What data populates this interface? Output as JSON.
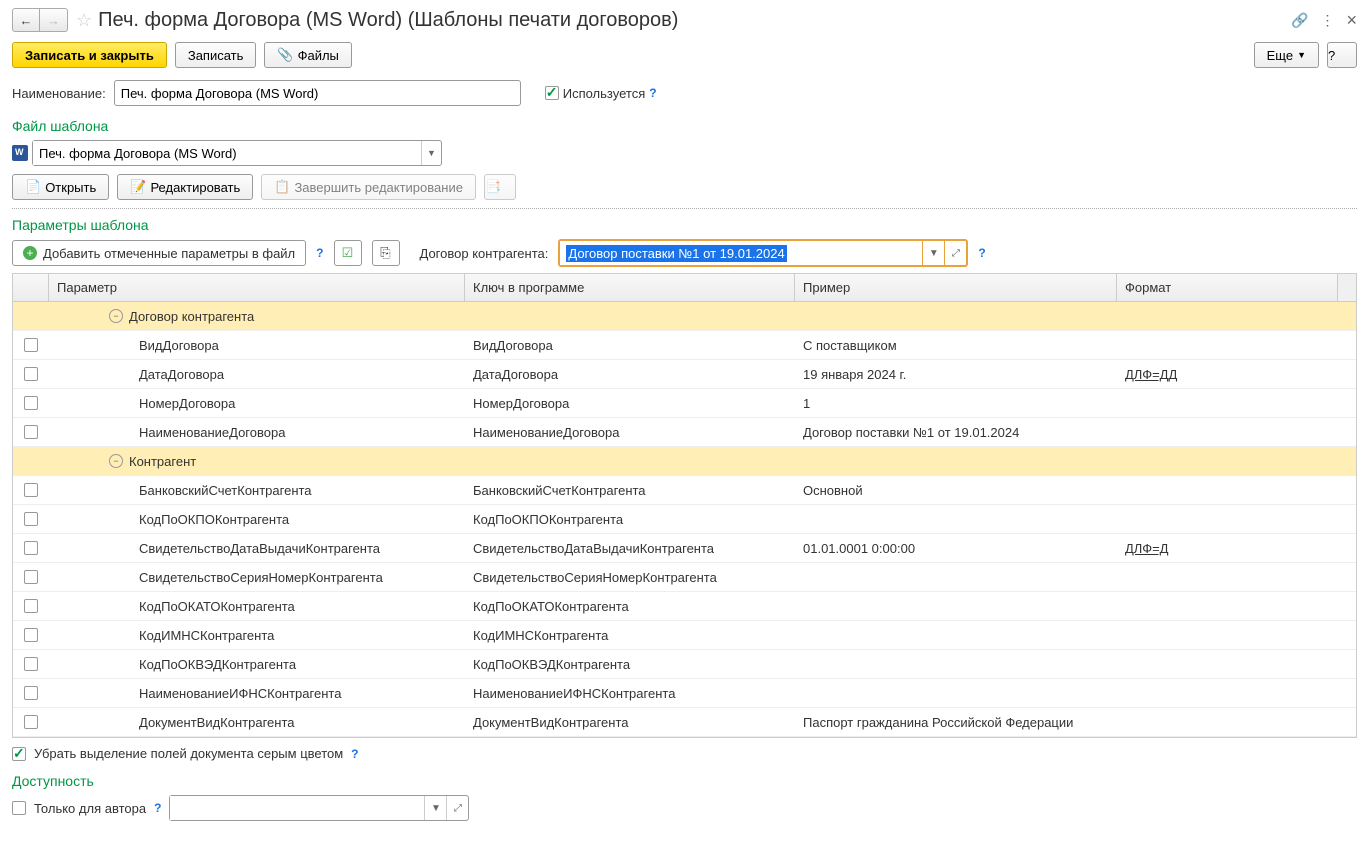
{
  "header": {
    "title": "Печ. форма Договора (MS Word) (Шаблоны печати договоров)"
  },
  "toolbar": {
    "save_close": "Записать и закрыть",
    "save": "Записать",
    "files": "Файлы",
    "more": "Еще"
  },
  "name_field": {
    "label": "Наименование:",
    "value": "Печ. форма Договора (MS Word)",
    "used_label": "Используется"
  },
  "template_file": {
    "title": "Файл шаблона",
    "value": "Печ. форма Договора (MS Word)",
    "open": "Открыть",
    "edit": "Редактировать",
    "finish_edit": "Завершить редактирование"
  },
  "params": {
    "title": "Параметры шаблона",
    "add_btn": "Добавить отмеченные параметры в файл",
    "contract_label": "Договор контрагента:",
    "contract_value": "Договор поставки №1 от 19.01.2024",
    "headers": {
      "param": "Параметр",
      "key": "Ключ в программе",
      "example": "Пример",
      "format": "Формат"
    },
    "rows": [
      {
        "type": "group",
        "indent": 1,
        "param": "Договор контрагента"
      },
      {
        "type": "row",
        "indent": 2,
        "param": "ВидДоговора",
        "key": "ВидДоговора",
        "example": "С поставщиком",
        "format": ""
      },
      {
        "type": "row",
        "indent": 2,
        "param": "ДатаДоговора",
        "key": "ДатаДоговора",
        "example": "19 января 2024 г.",
        "format": "ДЛФ=ДД"
      },
      {
        "type": "row",
        "indent": 2,
        "param": "НомерДоговора",
        "key": "НомерДоговора",
        "example": "1",
        "format": ""
      },
      {
        "type": "row",
        "indent": 2,
        "param": "НаименованиеДоговора",
        "key": "НаименованиеДоговора",
        "example": "Договор поставки №1 от 19.01.2024",
        "format": ""
      },
      {
        "type": "group",
        "indent": 1,
        "param": "Контрагент"
      },
      {
        "type": "row",
        "indent": 2,
        "param": "БанковскийСчетКонтрагента",
        "key": "БанковскийСчетКонтрагента",
        "example": "Основной",
        "format": ""
      },
      {
        "type": "row",
        "indent": 2,
        "param": "КодПоОКПОКонтрагента",
        "key": "КодПоОКПОКонтрагента",
        "example": "",
        "format": ""
      },
      {
        "type": "row",
        "indent": 2,
        "param": "СвидетельствоДатаВыдачиКонтрагента",
        "key": "СвидетельствоДатаВыдачиКонтрагента",
        "example": "01.01.0001 0:00:00",
        "format": "ДЛФ=Д"
      },
      {
        "type": "row",
        "indent": 2,
        "param": "СвидетельствоСерияНомерКонтрагента",
        "key": "СвидетельствоСерияНомерКонтрагента",
        "example": "",
        "format": ""
      },
      {
        "type": "row",
        "indent": 2,
        "param": "КодПоОКАТОКонтрагента",
        "key": "КодПоОКАТОКонтрагента",
        "example": "",
        "format": ""
      },
      {
        "type": "row",
        "indent": 2,
        "param": "КодИМНСКонтрагента",
        "key": "КодИМНСКонтрагента",
        "example": "",
        "format": ""
      },
      {
        "type": "row",
        "indent": 2,
        "param": "КодПоОКВЭДКонтрагента",
        "key": "КодПоОКВЭДКонтрагента",
        "example": "",
        "format": ""
      },
      {
        "type": "row",
        "indent": 2,
        "param": "НаименованиеИФНСКонтрагента",
        "key": "НаименованиеИФНСКонтрагента",
        "example": "",
        "format": ""
      },
      {
        "type": "row",
        "indent": 2,
        "param": "ДокументВидКонтрагента",
        "key": "ДокументВидКонтрагента",
        "example": "Паспорт гражданина Российской Федерации",
        "format": ""
      }
    ]
  },
  "remove_gray": "Убрать выделение полей документа серым цветом",
  "availability": {
    "title": "Доступность",
    "author_only": "Только для автора"
  }
}
